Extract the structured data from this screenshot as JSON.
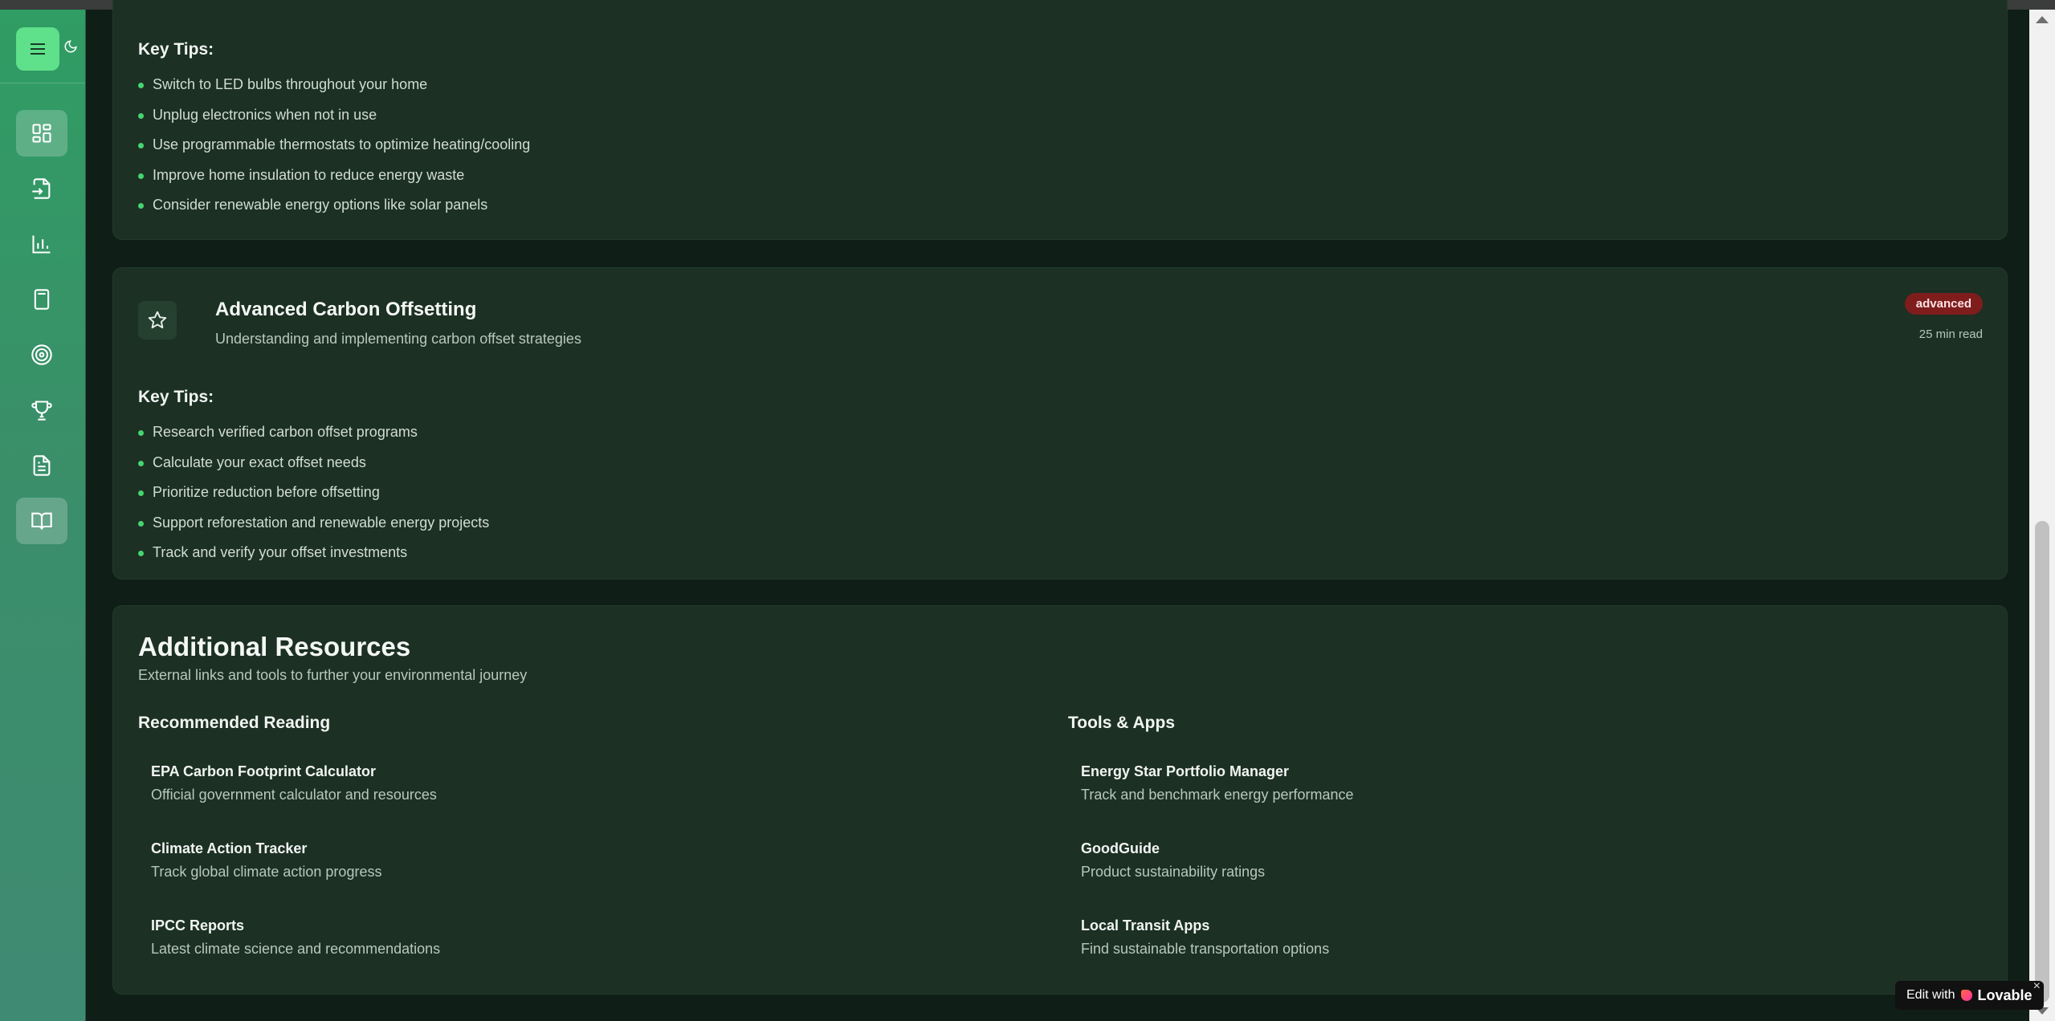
{
  "sidebar": {
    "items": [
      {
        "name": "dashboard",
        "active": false
      },
      {
        "name": "data-entry",
        "active": false
      },
      {
        "name": "analytics",
        "active": false
      },
      {
        "name": "calculator",
        "active": false
      },
      {
        "name": "goals",
        "active": false
      },
      {
        "name": "achievements",
        "active": false
      },
      {
        "name": "reports",
        "active": false
      },
      {
        "name": "education",
        "active": true
      }
    ]
  },
  "energy_card": {
    "key_tips_label": "Key Tips:",
    "tips": [
      "Switch to LED bulbs throughout your home",
      "Unplug electronics when not in use",
      "Use programmable thermostats to optimize heating/cooling",
      "Improve home insulation to reduce energy waste",
      "Consider renewable energy options like solar panels"
    ]
  },
  "offset_card": {
    "title": "Advanced Carbon Offsetting",
    "subtitle": "Understanding and implementing carbon offset strategies",
    "badge": "advanced",
    "read_time": "25 min read",
    "key_tips_label": "Key Tips:",
    "tips": [
      "Research verified carbon offset programs",
      "Calculate your exact offset needs",
      "Prioritize reduction before offsetting",
      "Support reforestation and renewable energy projects",
      "Track and verify your offset investments"
    ]
  },
  "resources": {
    "title": "Additional Resources",
    "subtitle": "External links and tools to further your environmental journey",
    "reading": {
      "title": "Recommended Reading",
      "items": [
        {
          "title": "EPA Carbon Footprint Calculator",
          "desc": "Official government calculator and resources"
        },
        {
          "title": "Climate Action Tracker",
          "desc": "Track global climate action progress"
        },
        {
          "title": "IPCC Reports",
          "desc": "Latest climate science and recommendations"
        }
      ]
    },
    "tools": {
      "title": "Tools & Apps",
      "items": [
        {
          "title": "Energy Star Portfolio Manager",
          "desc": "Track and benchmark energy performance"
        },
        {
          "title": "GoodGuide",
          "desc": "Product sustainability ratings"
        },
        {
          "title": "Local Transit Apps",
          "desc": "Find sustainable transportation options"
        }
      ]
    }
  },
  "lovable": {
    "edit_label": "Edit with",
    "brand": "Lovable",
    "close": "×"
  },
  "colors": {
    "accent": "#47d46f",
    "card_bg": "#1c3024",
    "badge_advanced": "#7f1d1d"
  }
}
